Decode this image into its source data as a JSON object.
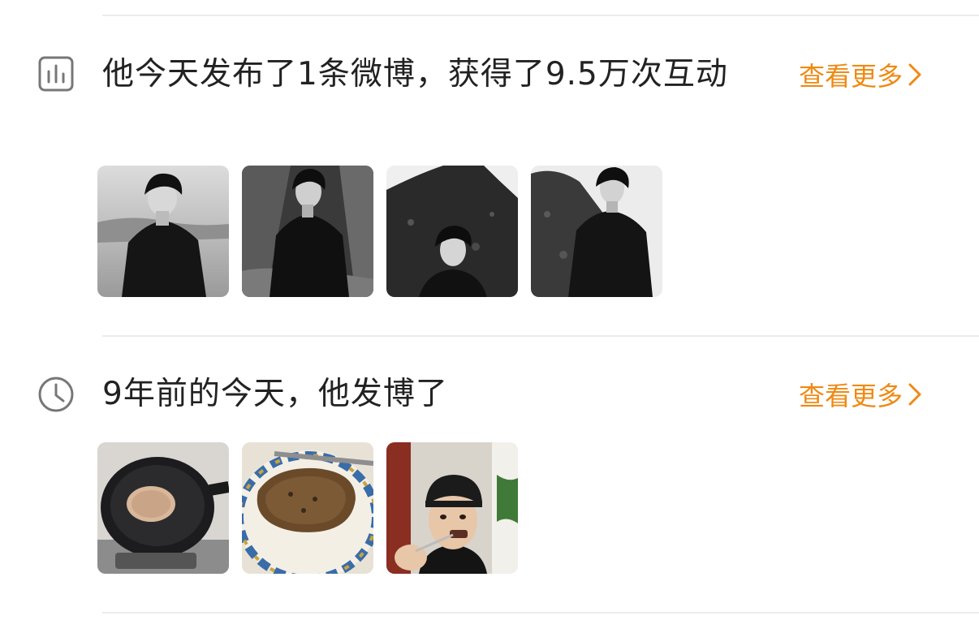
{
  "stats_section": {
    "title": "他今天发布了1条微博，获得了9.5万次互动",
    "more_label": "查看更多",
    "icon": "stats-chart-icon",
    "images": [
      {
        "icon": "photo-bw-portrait-1"
      },
      {
        "icon": "photo-bw-portrait-2"
      },
      {
        "icon": "photo-bw-portrait-3"
      },
      {
        "icon": "photo-bw-portrait-4"
      }
    ]
  },
  "memory_section": {
    "title": "9年前的今天，他发博了",
    "more_label": "查看更多",
    "icon": "clock-icon",
    "images": [
      {
        "icon": "photo-pan-cooking"
      },
      {
        "icon": "photo-steak-plate"
      },
      {
        "icon": "photo-selfie-eating"
      }
    ]
  },
  "colors": {
    "accent": "#ee8a13",
    "text": "#222222",
    "divider": "#ececec",
    "icon": "#777777"
  }
}
